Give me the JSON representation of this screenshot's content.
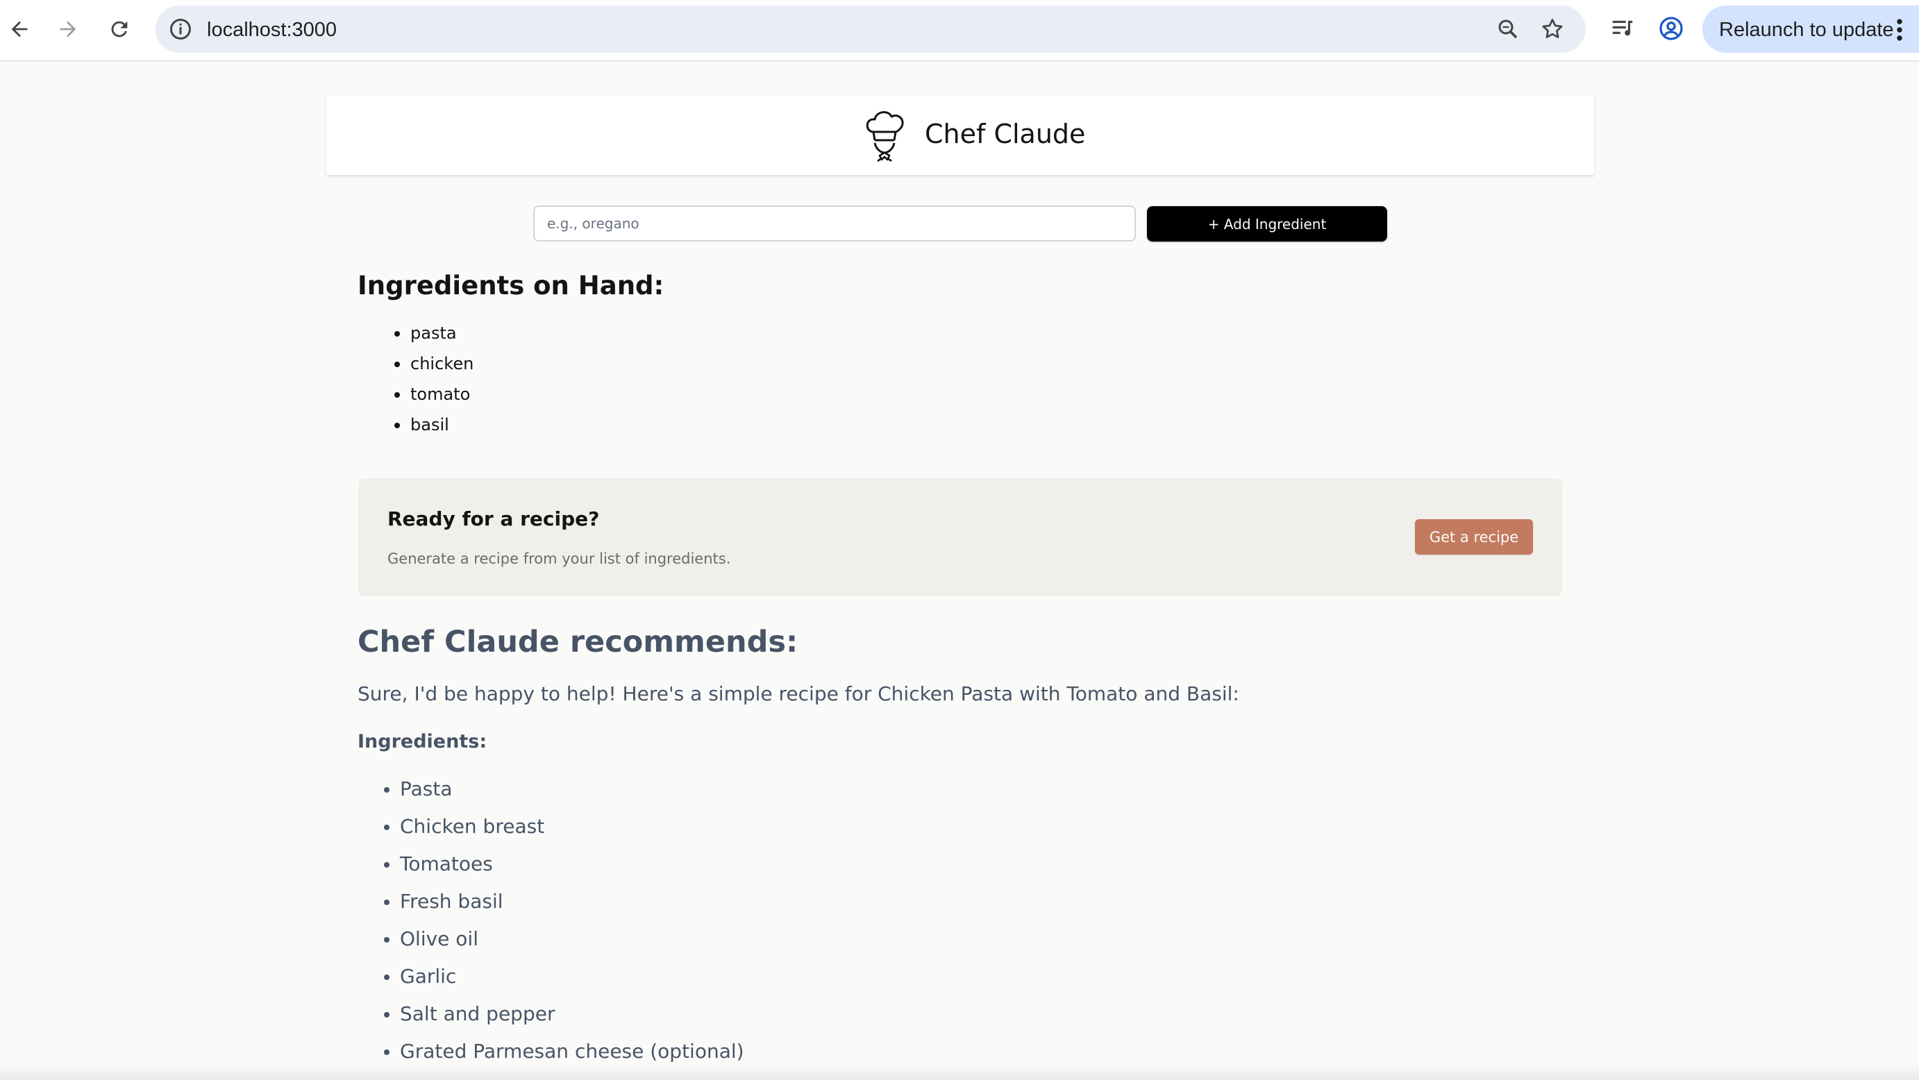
{
  "browser": {
    "url": "localhost:3000",
    "relaunch_label": "Relaunch to update"
  },
  "header": {
    "title": "Chef Claude",
    "logo_icon": "chef-hat-icon"
  },
  "ingredient_form": {
    "placeholder": "e.g., oregano",
    "value": "",
    "add_button_label": "+ Add Ingredient"
  },
  "ingredients_on_hand": {
    "title": "Ingredients on Hand:",
    "items": [
      "pasta",
      "chicken",
      "tomato",
      "basil"
    ]
  },
  "recipe_prompt": {
    "title": "Ready for a recipe?",
    "description": "Generate a recipe from your list of ingredients.",
    "button_label": "Get a recipe",
    "button_color": "#c27b5f"
  },
  "recommendation": {
    "title": "Chef Claude recommends:",
    "intro": "Sure, I'd be happy to help! Here's a simple recipe for Chicken Pasta with Tomato and Basil:",
    "ingredients_heading": "Ingredients:",
    "ingredients": [
      "Pasta",
      "Chicken breast",
      "Tomatoes",
      "Fresh basil",
      "Olive oil",
      "Garlic",
      "Salt and pepper",
      "Grated Parmesan cheese (optional)"
    ]
  }
}
